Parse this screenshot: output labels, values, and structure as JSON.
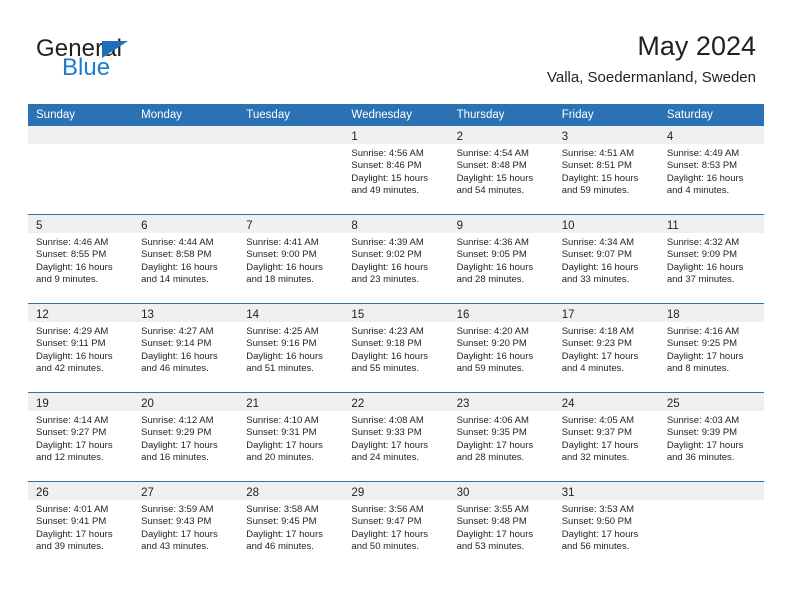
{
  "brand": {
    "word_one": "General",
    "word_two": "Blue",
    "triangle_color": "#1c6fb8",
    "blue_color": "#1c7ad1"
  },
  "header": {
    "title": "May 2024",
    "subtitle": "Valla, Soedermanland, Sweden",
    "accent_color": "#2b72b4",
    "band_color": "#f0f0f0"
  },
  "calendar": {
    "weekday_headers": [
      "Sunday",
      "Monday",
      "Tuesday",
      "Wednesday",
      "Thursday",
      "Friday",
      "Saturday"
    ],
    "labels": {
      "sunrise": "Sunrise:",
      "sunset": "Sunset:",
      "daylight": "Daylight:"
    },
    "weeks": [
      [
        {
          "day": "",
          "lines": []
        },
        {
          "day": "",
          "lines": []
        },
        {
          "day": "",
          "lines": []
        },
        {
          "day": "1",
          "lines": [
            "Sunrise: 4:56 AM",
            "Sunset: 8:46 PM",
            "Daylight: 15 hours",
            "and 49 minutes."
          ]
        },
        {
          "day": "2",
          "lines": [
            "Sunrise: 4:54 AM",
            "Sunset: 8:48 PM",
            "Daylight: 15 hours",
            "and 54 minutes."
          ]
        },
        {
          "day": "3",
          "lines": [
            "Sunrise: 4:51 AM",
            "Sunset: 8:51 PM",
            "Daylight: 15 hours",
            "and 59 minutes."
          ]
        },
        {
          "day": "4",
          "lines": [
            "Sunrise: 4:49 AM",
            "Sunset: 8:53 PM",
            "Daylight: 16 hours",
            "and 4 minutes."
          ]
        }
      ],
      [
        {
          "day": "5",
          "lines": [
            "Sunrise: 4:46 AM",
            "Sunset: 8:55 PM",
            "Daylight: 16 hours",
            "and 9 minutes."
          ]
        },
        {
          "day": "6",
          "lines": [
            "Sunrise: 4:44 AM",
            "Sunset: 8:58 PM",
            "Daylight: 16 hours",
            "and 14 minutes."
          ]
        },
        {
          "day": "7",
          "lines": [
            "Sunrise: 4:41 AM",
            "Sunset: 9:00 PM",
            "Daylight: 16 hours",
            "and 18 minutes."
          ]
        },
        {
          "day": "8",
          "lines": [
            "Sunrise: 4:39 AM",
            "Sunset: 9:02 PM",
            "Daylight: 16 hours",
            "and 23 minutes."
          ]
        },
        {
          "day": "9",
          "lines": [
            "Sunrise: 4:36 AM",
            "Sunset: 9:05 PM",
            "Daylight: 16 hours",
            "and 28 minutes."
          ]
        },
        {
          "day": "10",
          "lines": [
            "Sunrise: 4:34 AM",
            "Sunset: 9:07 PM",
            "Daylight: 16 hours",
            "and 33 minutes."
          ]
        },
        {
          "day": "11",
          "lines": [
            "Sunrise: 4:32 AM",
            "Sunset: 9:09 PM",
            "Daylight: 16 hours",
            "and 37 minutes."
          ]
        }
      ],
      [
        {
          "day": "12",
          "lines": [
            "Sunrise: 4:29 AM",
            "Sunset: 9:11 PM",
            "Daylight: 16 hours",
            "and 42 minutes."
          ]
        },
        {
          "day": "13",
          "lines": [
            "Sunrise: 4:27 AM",
            "Sunset: 9:14 PM",
            "Daylight: 16 hours",
            "and 46 minutes."
          ]
        },
        {
          "day": "14",
          "lines": [
            "Sunrise: 4:25 AM",
            "Sunset: 9:16 PM",
            "Daylight: 16 hours",
            "and 51 minutes."
          ]
        },
        {
          "day": "15",
          "lines": [
            "Sunrise: 4:23 AM",
            "Sunset: 9:18 PM",
            "Daylight: 16 hours",
            "and 55 minutes."
          ]
        },
        {
          "day": "16",
          "lines": [
            "Sunrise: 4:20 AM",
            "Sunset: 9:20 PM",
            "Daylight: 16 hours",
            "and 59 minutes."
          ]
        },
        {
          "day": "17",
          "lines": [
            "Sunrise: 4:18 AM",
            "Sunset: 9:23 PM",
            "Daylight: 17 hours",
            "and 4 minutes."
          ]
        },
        {
          "day": "18",
          "lines": [
            "Sunrise: 4:16 AM",
            "Sunset: 9:25 PM",
            "Daylight: 17 hours",
            "and 8 minutes."
          ]
        }
      ],
      [
        {
          "day": "19",
          "lines": [
            "Sunrise: 4:14 AM",
            "Sunset: 9:27 PM",
            "Daylight: 17 hours",
            "and 12 minutes."
          ]
        },
        {
          "day": "20",
          "lines": [
            "Sunrise: 4:12 AM",
            "Sunset: 9:29 PM",
            "Daylight: 17 hours",
            "and 16 minutes."
          ]
        },
        {
          "day": "21",
          "lines": [
            "Sunrise: 4:10 AM",
            "Sunset: 9:31 PM",
            "Daylight: 17 hours",
            "and 20 minutes."
          ]
        },
        {
          "day": "22",
          "lines": [
            "Sunrise: 4:08 AM",
            "Sunset: 9:33 PM",
            "Daylight: 17 hours",
            "and 24 minutes."
          ]
        },
        {
          "day": "23",
          "lines": [
            "Sunrise: 4:06 AM",
            "Sunset: 9:35 PM",
            "Daylight: 17 hours",
            "and 28 minutes."
          ]
        },
        {
          "day": "24",
          "lines": [
            "Sunrise: 4:05 AM",
            "Sunset: 9:37 PM",
            "Daylight: 17 hours",
            "and 32 minutes."
          ]
        },
        {
          "day": "25",
          "lines": [
            "Sunrise: 4:03 AM",
            "Sunset: 9:39 PM",
            "Daylight: 17 hours",
            "and 36 minutes."
          ]
        }
      ],
      [
        {
          "day": "26",
          "lines": [
            "Sunrise: 4:01 AM",
            "Sunset: 9:41 PM",
            "Daylight: 17 hours",
            "and 39 minutes."
          ]
        },
        {
          "day": "27",
          "lines": [
            "Sunrise: 3:59 AM",
            "Sunset: 9:43 PM",
            "Daylight: 17 hours",
            "and 43 minutes."
          ]
        },
        {
          "day": "28",
          "lines": [
            "Sunrise: 3:58 AM",
            "Sunset: 9:45 PM",
            "Daylight: 17 hours",
            "and 46 minutes."
          ]
        },
        {
          "day": "29",
          "lines": [
            "Sunrise: 3:56 AM",
            "Sunset: 9:47 PM",
            "Daylight: 17 hours",
            "and 50 minutes."
          ]
        },
        {
          "day": "30",
          "lines": [
            "Sunrise: 3:55 AM",
            "Sunset: 9:48 PM",
            "Daylight: 17 hours",
            "and 53 minutes."
          ]
        },
        {
          "day": "31",
          "lines": [
            "Sunrise: 3:53 AM",
            "Sunset: 9:50 PM",
            "Daylight: 17 hours",
            "and 56 minutes."
          ]
        },
        {
          "day": "",
          "lines": []
        }
      ]
    ]
  }
}
